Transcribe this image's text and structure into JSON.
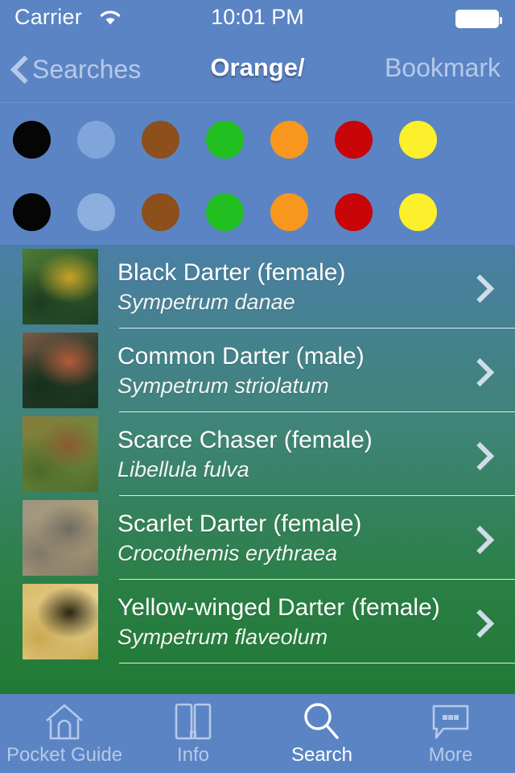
{
  "statusbar": {
    "carrier": "Carrier",
    "wifi_icon": "wifi-icon",
    "time": "10:01 PM",
    "battery_icon": "battery-full-icon"
  },
  "navbar": {
    "back_label": "Searches",
    "back_icon": "chevron-left-icon",
    "title": "Orange/",
    "right_label": "Bookmark"
  },
  "swatches": {
    "row1": [
      {
        "name": "swatch-black",
        "color": "#050505"
      },
      {
        "name": "swatch-light-blue",
        "color": "#7fa5da"
      },
      {
        "name": "swatch-brown",
        "color": "#8d4f1c"
      },
      {
        "name": "swatch-green",
        "color": "#22c021"
      },
      {
        "name": "swatch-orange",
        "color": "#f8971d"
      },
      {
        "name": "swatch-red",
        "color": "#c80508"
      },
      {
        "name": "swatch-yellow",
        "color": "#fcef2c"
      }
    ],
    "row2": [
      {
        "name": "swatch-black",
        "color": "#050505"
      },
      {
        "name": "swatch-light-blue",
        "color": "#8cafe0"
      },
      {
        "name": "swatch-brown",
        "color": "#8d4f1c"
      },
      {
        "name": "swatch-green",
        "color": "#22c021"
      },
      {
        "name": "swatch-orange",
        "color": "#f8971d"
      },
      {
        "name": "swatch-red",
        "color": "#c80508"
      },
      {
        "name": "swatch-yellow",
        "color": "#fcef2c"
      }
    ]
  },
  "list": {
    "rows": [
      {
        "title": "Black Darter (female)",
        "subtitle": "Sympetrum danae",
        "thumb": "dragonfly-on-green-background",
        "thumb_colors": [
          "#4d7a33",
          "#2f5b2a",
          "#c9a227",
          "#1d3b22"
        ]
      },
      {
        "title": "Common Darter (male)",
        "subtitle": "Sympetrum striolatum",
        "thumb": "dragonfly-on-dark-background",
        "thumb_colors": [
          "#7a5a43",
          "#2a3b2c",
          "#b55a3a",
          "#14301c"
        ]
      },
      {
        "title": "Scarce Chaser (female)",
        "subtitle": "Libellula fulva",
        "thumb": "dragonfly-on-foliage",
        "thumb_colors": [
          "#8a7a3a",
          "#6d8a3c",
          "#8b5a32",
          "#4d6a2a"
        ]
      },
      {
        "title": "Scarlet Darter (female)",
        "subtitle": "Crocothemis erythraea",
        "thumb": "dragonfly-on-grey-stem",
        "thumb_colors": [
          "#9a9384",
          "#b4a278",
          "#6e6b62",
          "#7f7769"
        ]
      },
      {
        "title": "Yellow-winged Darter (female)",
        "subtitle": "Sympetrum flaveolum",
        "thumb": "yellow-winged-dragonfly-closeup",
        "thumb_colors": [
          "#d8b96a",
          "#e8d292",
          "#2a2410",
          "#c8a84e"
        ]
      }
    ],
    "chevron_icon": "chevron-right-icon"
  },
  "tabbar": {
    "tabs": [
      {
        "label": "Pocket Guide",
        "icon": "home-icon",
        "active": false
      },
      {
        "label": "Info",
        "icon": "book-icon",
        "active": false
      },
      {
        "label": "Search",
        "icon": "search-icon",
        "active": true
      },
      {
        "label": "More",
        "icon": "speech-bubble-icon",
        "active": false
      }
    ]
  },
  "colors": {
    "chrome_blue": "#5b84c4",
    "inactive_tint": "#b6c9e8",
    "active_tint": "#ffffff",
    "list_top": "#4a7fa5",
    "list_bottom": "#217a35"
  }
}
